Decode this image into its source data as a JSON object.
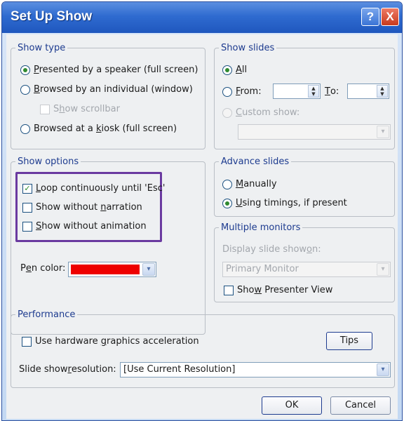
{
  "window": {
    "title": "Set Up Show",
    "help_label": "?",
    "close_label": "X"
  },
  "show_type": {
    "legend": "Show type",
    "options": [
      {
        "pre": "",
        "key": "P",
        "post": "resented by a speaker (full screen)",
        "selected": true
      },
      {
        "pre": "",
        "key": "B",
        "post": "rowsed by an individual (window)",
        "selected": false
      },
      {
        "pre": "Browsed at a ",
        "key": "k",
        "post": "iosk (full screen)",
        "selected": false
      }
    ],
    "scrollbar": {
      "pre": "S",
      "key": "h",
      "post": "ow scrollbar",
      "checked": false,
      "enabled": false
    }
  },
  "show_slides": {
    "legend": "Show slides",
    "all": {
      "key": "A",
      "post": "ll",
      "selected": true
    },
    "from": {
      "key": "F",
      "post": "rom:",
      "value": "",
      "selected": false
    },
    "to": {
      "key": "T",
      "post": "o:",
      "value": ""
    },
    "custom": {
      "key": "C",
      "post": "ustom show:",
      "selected": false,
      "enabled": false
    },
    "custom_value": ""
  },
  "show_options": {
    "legend": "Show options",
    "items": [
      {
        "pre": "",
        "key": "L",
        "post": "oop continuously until 'Esc'",
        "checked": true
      },
      {
        "pre": "Show without ",
        "key": "n",
        "post": "arration",
        "checked": false
      },
      {
        "pre": "",
        "key": "S",
        "post": "how without animation",
        "checked": false
      }
    ],
    "pen_color": {
      "pre": "P",
      "key": "e",
      "post": "n color:",
      "value_color": "#ee0000"
    }
  },
  "advance_slides": {
    "legend": "Advance slides",
    "options": [
      {
        "pre": "",
        "key": "M",
        "post": "anually",
        "selected": false
      },
      {
        "pre": "",
        "key": "U",
        "post": "sing timings, if present",
        "selected": true
      }
    ]
  },
  "multiple_monitors": {
    "legend": "Multiple monitors",
    "display_label": {
      "pre": "Display slide show ",
      "key": "o",
      "post": "n:"
    },
    "display_value": "Primary Monitor",
    "presenter": {
      "pre": "Sho",
      "key": "w",
      "post": " Presenter View",
      "checked": false
    }
  },
  "performance": {
    "legend": "Performance",
    "hw_accel": {
      "pre": "Use hardware ",
      "key": "g",
      "post": "raphics acceleration",
      "checked": false
    },
    "tips_label": "Tips",
    "resolution_label": {
      "pre": "Slide show ",
      "key": "r",
      "post": "esolution:"
    },
    "resolution_value": "[Use Current Resolution]"
  },
  "footer": {
    "ok_label": "OK",
    "cancel_label": "Cancel"
  },
  "icons": {
    "check": "✓",
    "spin_up": "▲",
    "spin_down": "▼",
    "dropdown": "▾"
  }
}
